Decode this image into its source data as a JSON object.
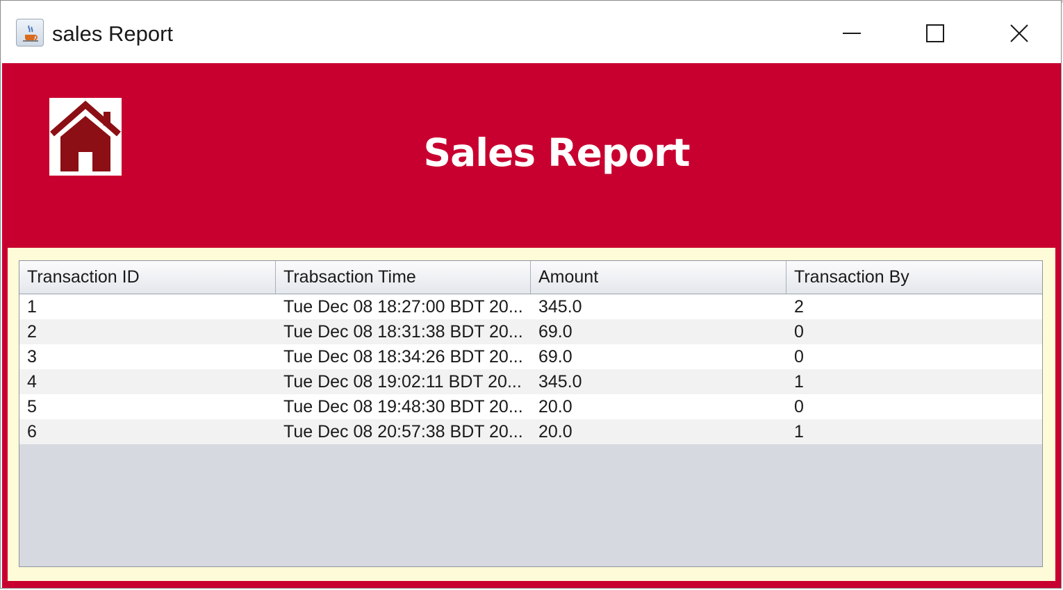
{
  "window": {
    "title": "sales Report",
    "icon": "java-cup-icon",
    "controls": {
      "minimize": "minimize-icon",
      "maximize": "maximize-icon",
      "close": "close-icon"
    }
  },
  "header": {
    "title": "Sales Report",
    "home_icon": "home-icon",
    "background_color": "#c80030"
  },
  "table": {
    "columns": [
      "Transaction ID",
      "Trabsaction Time",
      "Amount",
      "Transaction By"
    ],
    "rows": [
      [
        "1",
        "Tue Dec 08 18:27:00 BDT 20...",
        "345.0",
        "2"
      ],
      [
        "2",
        "Tue Dec 08 18:31:38 BDT 20...",
        "69.0",
        "0"
      ],
      [
        "3",
        "Tue Dec 08 18:34:26 BDT 20...",
        "69.0",
        "0"
      ],
      [
        "4",
        "Tue Dec 08 19:02:11 BDT 20...",
        "345.0",
        "1"
      ],
      [
        "5",
        "Tue Dec 08 19:48:30 BDT 20...",
        "20.0",
        "0"
      ],
      [
        "6",
        "Tue Dec 08 20:57:38 BDT 20...",
        "20.0",
        "1"
      ]
    ]
  }
}
